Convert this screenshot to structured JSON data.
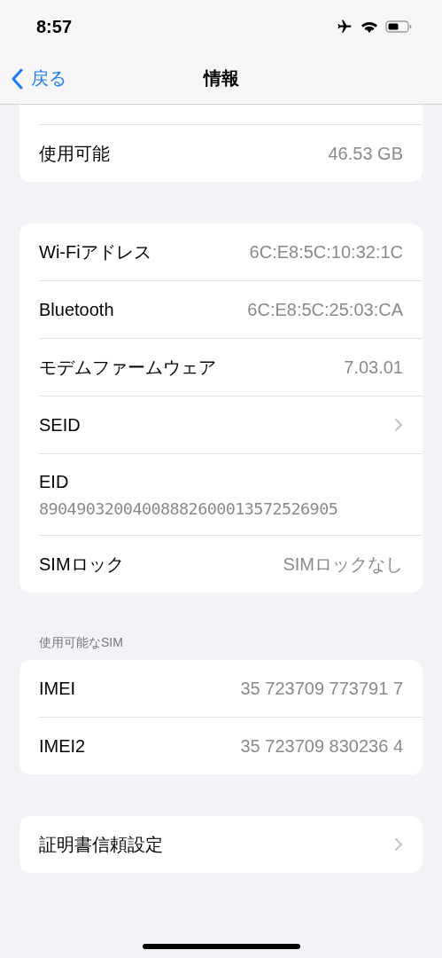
{
  "status_bar": {
    "time": "8:57"
  },
  "nav": {
    "back": "戻る",
    "title": "情報"
  },
  "sections": [
    {
      "clipped_top": true,
      "rows": [
        {
          "kind": "value",
          "label": "使用可能",
          "value": "46.53 GB"
        }
      ]
    },
    {
      "rows": [
        {
          "kind": "value",
          "label": "Wi-Fiアドレス",
          "value": "6C:E8:5C:10:32:1C"
        },
        {
          "kind": "value",
          "label": "Bluetooth",
          "value": "6C:E8:5C:25:03:CA"
        },
        {
          "kind": "value",
          "label": "モデムファームウェア",
          "value": "7.03.01"
        },
        {
          "kind": "chevron",
          "label": "SEID"
        },
        {
          "kind": "stacked",
          "label": "EID",
          "value": "89049032004008882600013572526905"
        },
        {
          "kind": "value",
          "label": "SIMロック",
          "value": "SIMロックなし"
        }
      ]
    },
    {
      "header": "使用可能なSIM",
      "rows": [
        {
          "kind": "value",
          "label": "IMEI",
          "value": "35 723709 773791 7"
        },
        {
          "kind": "value",
          "label": "IMEI2",
          "value": "35 723709 830236 4"
        }
      ]
    },
    {
      "rows": [
        {
          "kind": "chevron",
          "label": "証明書信頼設定"
        }
      ]
    }
  ]
}
